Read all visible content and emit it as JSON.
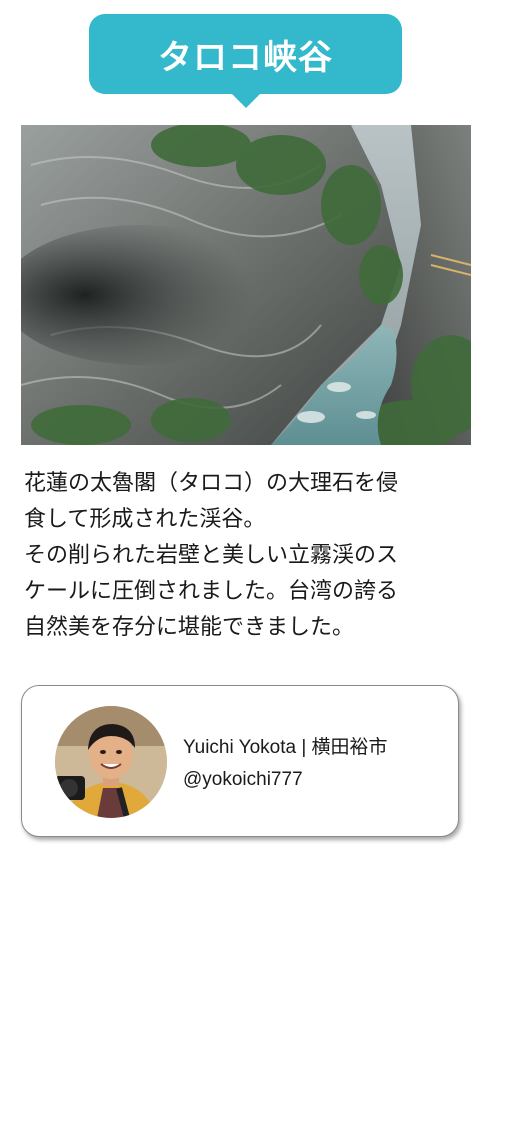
{
  "title": "タロコ峡谷",
  "photo": {
    "subject": "gorge-photo"
  },
  "description": {
    "lines": [
      "花蓮の太魯閣（タロコ）の大理石を侵",
      "食して形成された渓谷。",
      "その削られた岩壁と美しい立霧渓のス",
      "ケールに圧倒されました。台湾の誇る",
      "自然美を存分に堪能できました。"
    ]
  },
  "profile": {
    "name_line": "Yuichi Yokota | 横田裕市",
    "handle": "@yokoichi777"
  },
  "colors": {
    "accent": "#33b9cb",
    "text": "#1a1a1a",
    "card_border": "#8a8a8a"
  }
}
